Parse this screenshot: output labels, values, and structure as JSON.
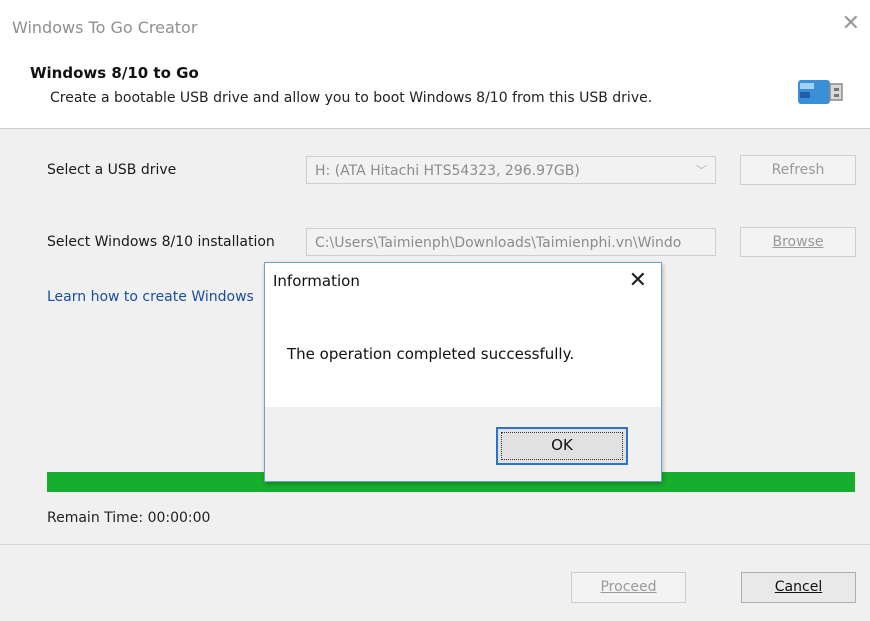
{
  "window": {
    "title": "Windows To Go Creator",
    "close_glyph": "✕"
  },
  "header": {
    "title": "Windows 8/10 to Go",
    "subtitle": "Create a bootable USB drive and allow you to boot Windows 8/10 from this USB drive.",
    "icon": "usb-drive-icon"
  },
  "usb": {
    "label": "Select a USB drive",
    "value": "H: (ATA    Hitachi HTS54323, 296.97GB)",
    "refresh_label": "Refresh"
  },
  "installation": {
    "label": "Select Windows 8/10 installation",
    "value": "C:\\Users\\Taimienph\\Downloads\\Taimienphi.vn\\Windo",
    "browse_label": "Browse"
  },
  "link": {
    "text": "Learn how to create Windows"
  },
  "progress": {
    "percent": 100,
    "remain_label": "Remain Time: 00:00:00"
  },
  "buttons": {
    "proceed": "Proceed",
    "cancel": "Cancel"
  },
  "dialog": {
    "title": "Information",
    "message": "The operation completed successfully.",
    "ok": "OK",
    "close_glyph": "✕"
  },
  "colors": {
    "progress_fill": "#16ae2c",
    "link": "#1a4ea0",
    "dialog_border": "#6da1c7",
    "ok_focus": "#2a74c9"
  }
}
